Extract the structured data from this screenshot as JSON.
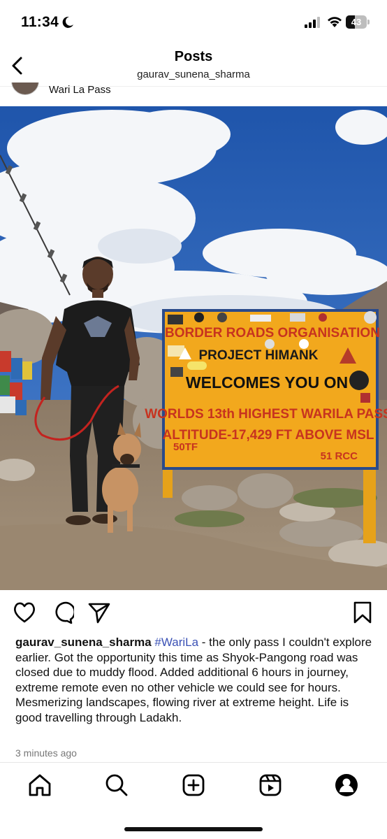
{
  "status_bar": {
    "time": "11:34",
    "battery_level": "43",
    "icons": [
      "moon-icon",
      "signal-icon",
      "wifi-icon",
      "battery-icon"
    ]
  },
  "header": {
    "title": "Posts",
    "subtitle": "gaurav_sunena_sharma",
    "back_icon": "chevron-left-icon"
  },
  "post": {
    "location": "Wari La Pass",
    "photo": {
      "sign": {
        "line1": "BORDER ROADS ORGANISATION",
        "line2": "PROJECT HIMANK",
        "line3": "WELCOMES YOU ON",
        "line4": "WORLDS 13th HIGHEST WARILA PASS",
        "line5": "ALTITUDE-17,429 FT ABOVE MSL",
        "corner_left": "50TF",
        "corner_right": "51 RCC"
      }
    },
    "actions": {
      "like_icon": "heart-icon",
      "comment_icon": "comment-icon",
      "share_icon": "send-icon",
      "save_icon": "bookmark-icon"
    },
    "caption": {
      "username": "gaurav_sunena_sharma",
      "hashtag": "#WariLa",
      "text": " - the only pass I couldn't explore earlier. Got the opportunity this time as Shyok-Pangong road was closed due to muddy flood. Added additional 6 hours in journey, extreme remote even no other vehicle we could see for hours. Mesmerizing landscapes, flowing river at extreme height. Life is good travelling through Ladakh."
    },
    "timestamp": "3 minutes ago"
  },
  "nav": {
    "items": [
      "home-icon",
      "search-icon",
      "create-icon",
      "reels-icon",
      "profile-icon"
    ]
  },
  "colors": {
    "sky": "#2c63b8",
    "sign": "#f2a81d",
    "sign_border": "#2a4a8a",
    "hashtag": "#3a51b5"
  }
}
